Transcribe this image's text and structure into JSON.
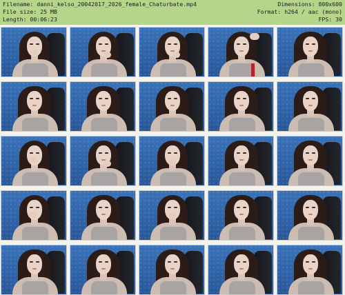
{
  "header": {
    "filename": "Filename: danni_kelso_20042017_2026_female_Chaturbate.mp4",
    "filesize": "File size: 25 MB",
    "length": "Length: 00:06:23",
    "dimensions": "Dimensions: 800x600",
    "format": "Format: h264 / aac (mono)",
    "fps": "FPS: 30"
  },
  "colors": {
    "header_bg": "#b5d58b",
    "wall": "#3a72b8"
  },
  "thumbnails": {
    "rows": 5,
    "columns": 5,
    "variants": [
      [
        "v1",
        "v2",
        "v2",
        "v3",
        "v4"
      ],
      [
        "v4",
        "v4",
        "v4",
        "v4",
        "v4"
      ],
      [
        "v5",
        "v2",
        "v1",
        "v4",
        "v4"
      ],
      [
        "v5",
        "v4",
        "v1",
        "v4",
        "v4"
      ],
      [
        "v4",
        "v4",
        "v4",
        "v4",
        "v4"
      ]
    ],
    "red_accent_cell": [
      0,
      3
    ]
  }
}
